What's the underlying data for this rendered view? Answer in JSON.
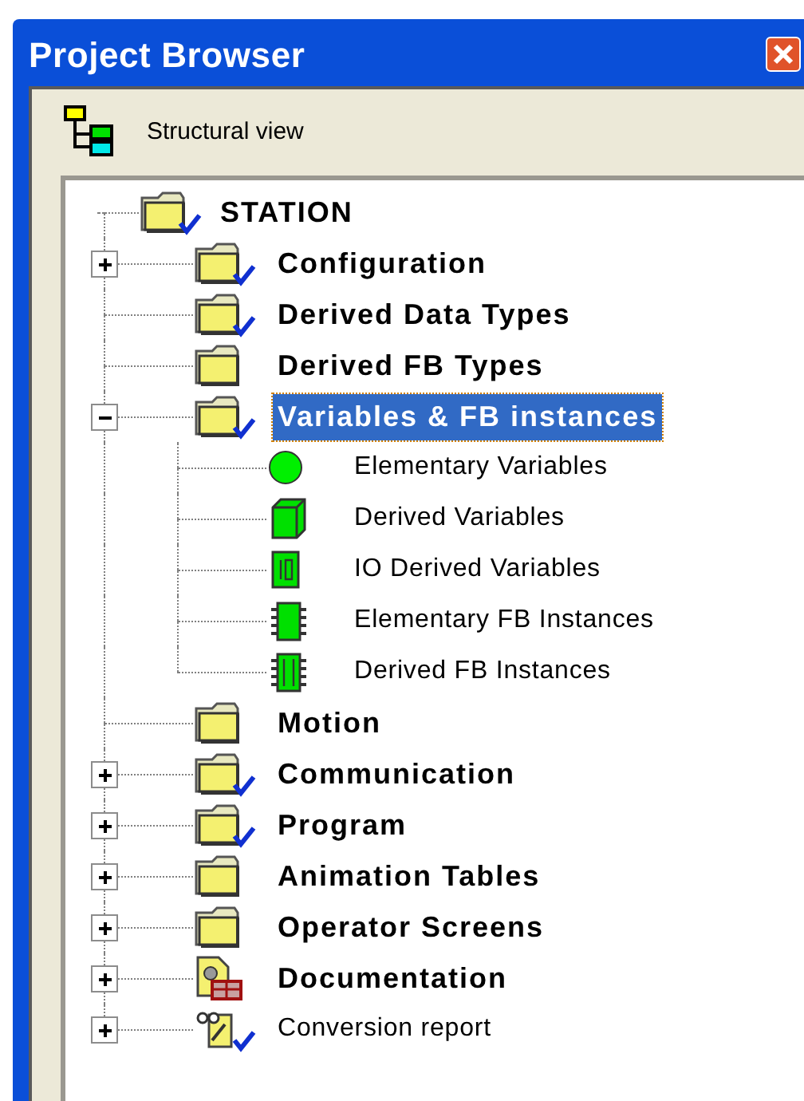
{
  "window": {
    "title": "Project Browser"
  },
  "toolbar": {
    "view_label": "Structural view"
  },
  "tree": {
    "label": "STATION",
    "kind": "folder",
    "built": true,
    "bold": true,
    "selected": false,
    "children": [
      {
        "label": "Configuration",
        "kind": "folder",
        "built": true,
        "bold": true,
        "selected": false,
        "expanded": false
      },
      {
        "label": "Derived Data Types",
        "kind": "folder",
        "built": true,
        "bold": true,
        "selected": false
      },
      {
        "label": "Derived FB Types",
        "kind": "folder",
        "built": false,
        "bold": true,
        "selected": false
      },
      {
        "label": "Variables & FB instances",
        "kind": "folder",
        "built": true,
        "bold": true,
        "selected": true,
        "expanded": true,
        "children": [
          {
            "label": "Elementary Variables",
            "kind": "ball",
            "built": false,
            "bold": false,
            "selected": false
          },
          {
            "label": "Derived Variables",
            "kind": "cube",
            "built": false,
            "bold": false,
            "selected": false
          },
          {
            "label": "IO Derived Variables",
            "kind": "io",
            "built": false,
            "bold": false,
            "selected": false
          },
          {
            "label": "Elementary FB Instances",
            "kind": "chip",
            "built": false,
            "bold": false,
            "selected": false
          },
          {
            "label": "Derived FB Instances",
            "kind": "chip2",
            "built": false,
            "bold": false,
            "selected": false
          }
        ]
      },
      {
        "label": "Motion",
        "kind": "folder",
        "built": false,
        "bold": true,
        "selected": false
      },
      {
        "label": "Communication",
        "kind": "folder",
        "built": true,
        "bold": true,
        "selected": false,
        "expanded": false
      },
      {
        "label": "Program",
        "kind": "folder",
        "built": true,
        "bold": true,
        "selected": false,
        "expanded": false
      },
      {
        "label": "Animation Tables",
        "kind": "folder",
        "built": false,
        "bold": true,
        "selected": false,
        "expanded": false
      },
      {
        "label": "Operator Screens",
        "kind": "folder",
        "built": false,
        "bold": true,
        "selected": false,
        "expanded": false
      },
      {
        "label": "Documentation",
        "kind": "documentation",
        "built": false,
        "bold": true,
        "selected": false,
        "expanded": false
      },
      {
        "label": "Conversion report",
        "kind": "report",
        "built": true,
        "bold": false,
        "selected": false,
        "expanded": false
      }
    ]
  }
}
